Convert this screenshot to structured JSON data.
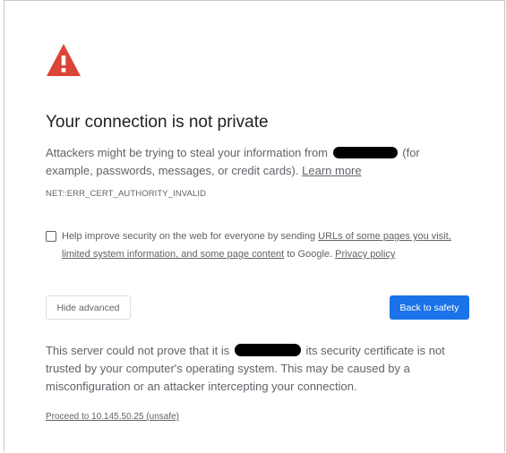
{
  "heading": "Your connection is not private",
  "intro": {
    "before": "Attackers might be trying to steal your information from",
    "after": "(for example, passwords, messages, or credit cards).",
    "learn_more": "Learn more"
  },
  "error_code": "NET::ERR_CERT_AUTHORITY_INVALID",
  "opt_in": {
    "checked": false,
    "before": "Help improve security on the web for everyone by sending",
    "link": "URLs of some pages you visit, limited system information, and some page content",
    "middle": "to Google.",
    "privacy_link": "Privacy policy"
  },
  "buttons": {
    "hide_advanced": "Hide advanced",
    "back_to_safety": "Back to safety"
  },
  "details": {
    "before": "This server could not prove that it is",
    "after": "its security certificate is not trusted by your computer's operating system. This may be caused by a misconfiguration or an attacker intercepting your connection."
  },
  "proceed_link": "Proceed to 10.145.50.25 (unsafe)",
  "colors": {
    "warning_red": "#db4437",
    "primary_blue": "#1a73e8",
    "text_secondary": "#5f6368",
    "heading": "#202124"
  },
  "icons": {
    "warning": "warning-triangle-icon"
  }
}
